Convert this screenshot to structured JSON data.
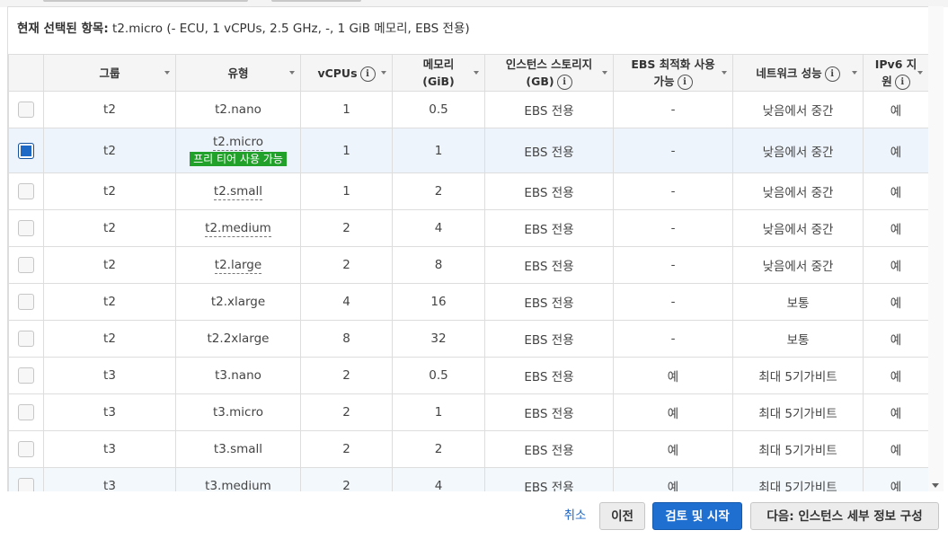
{
  "selection": {
    "label": "현재 선택된 항목:",
    "value": "t2.micro (- ECU, 1 vCPUs, 2.5 GHz, -, 1 GiB 메모리, EBS 전용)"
  },
  "table": {
    "columns": {
      "group": "그룹",
      "type": "유형",
      "vcpus": "vCPUs",
      "memory_l1": "메모리",
      "memory_l2": "(GiB)",
      "storage_l1": "인스턴스 스토리지",
      "storage_l2": "(GB)",
      "ebs_l1": "EBS 최적화 사용",
      "ebs_l2": "가능",
      "network": "네트워크 성능",
      "ipv6_l1": "IPv6 지",
      "ipv6_l2": "원"
    },
    "info_icon": "i",
    "free_tier_badge": "프리 티어 사용 가능",
    "rows": [
      {
        "group": "t2",
        "type": "t2.nano",
        "vcpus": "1",
        "memory": "0.5",
        "storage": "EBS 전용",
        "ebs": "-",
        "network": "낮음에서 중간",
        "ipv6": "예"
      },
      {
        "group": "t2",
        "type": "t2.micro",
        "vcpus": "1",
        "memory": "1",
        "storage": "EBS 전용",
        "ebs": "-",
        "network": "낮음에서 중간",
        "ipv6": "예"
      },
      {
        "group": "t2",
        "type": "t2.small",
        "vcpus": "1",
        "memory": "2",
        "storage": "EBS 전용",
        "ebs": "-",
        "network": "낮음에서 중간",
        "ipv6": "예"
      },
      {
        "group": "t2",
        "type": "t2.medium",
        "vcpus": "2",
        "memory": "4",
        "storage": "EBS 전용",
        "ebs": "-",
        "network": "낮음에서 중간",
        "ipv6": "예"
      },
      {
        "group": "t2",
        "type": "t2.large",
        "vcpus": "2",
        "memory": "8",
        "storage": "EBS 전용",
        "ebs": "-",
        "network": "낮음에서 중간",
        "ipv6": "예"
      },
      {
        "group": "t2",
        "type": "t2.xlarge",
        "vcpus": "4",
        "memory": "16",
        "storage": "EBS 전용",
        "ebs": "-",
        "network": "보통",
        "ipv6": "예"
      },
      {
        "group": "t2",
        "type": "t2.2xlarge",
        "vcpus": "8",
        "memory": "32",
        "storage": "EBS 전용",
        "ebs": "-",
        "network": "보통",
        "ipv6": "예"
      },
      {
        "group": "t3",
        "type": "t3.nano",
        "vcpus": "2",
        "memory": "0.5",
        "storage": "EBS 전용",
        "ebs": "예",
        "network": "최대 5기가비트",
        "ipv6": "예"
      },
      {
        "group": "t3",
        "type": "t3.micro",
        "vcpus": "2",
        "memory": "1",
        "storage": "EBS 전용",
        "ebs": "예",
        "network": "최대 5기가비트",
        "ipv6": "예"
      },
      {
        "group": "t3",
        "type": "t3.small",
        "vcpus": "2",
        "memory": "2",
        "storage": "EBS 전용",
        "ebs": "예",
        "network": "최대 5기가비트",
        "ipv6": "예"
      },
      {
        "group": "t3",
        "type": "t3.medium",
        "vcpus": "2",
        "memory": "4",
        "storage": "EBS 전용",
        "ebs": "예",
        "network": "최대 5기가비트",
        "ipv6": "예"
      }
    ]
  },
  "footer": {
    "cancel": "취소",
    "previous": "이전",
    "review_launch": "검토 및 시작",
    "next": "다음: 인스턴스 세부 정보 구성"
  },
  "colors": {
    "primary_button": "#1f6fd1",
    "badge": "#21a02a",
    "selected_row": "#eef4fb",
    "checkbox_checked": "#1f69c6"
  }
}
